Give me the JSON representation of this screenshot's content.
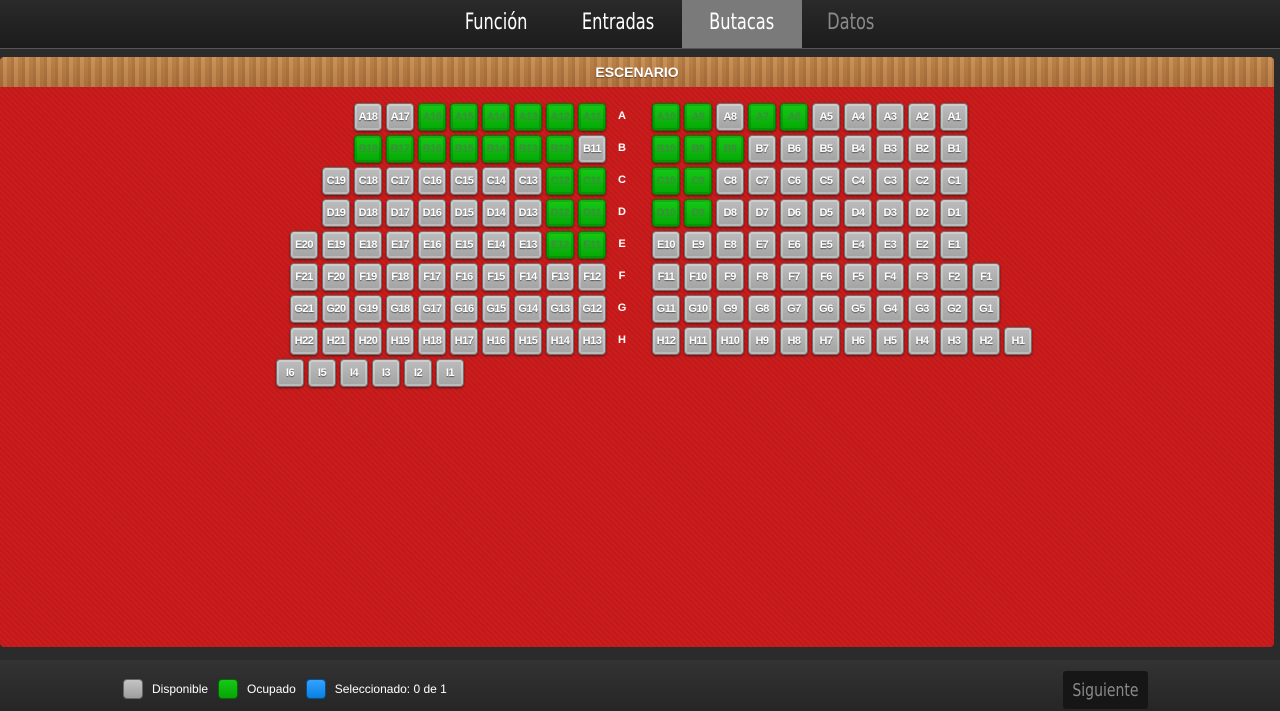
{
  "nav": {
    "tabs": [
      {
        "label": "Función",
        "state": "normal"
      },
      {
        "label": "Entradas",
        "state": "normal"
      },
      {
        "label": "Butacas",
        "state": "active"
      },
      {
        "label": "Datos",
        "state": "disabled"
      }
    ]
  },
  "stage": {
    "label": "ESCENARIO"
  },
  "rows": [
    {
      "label": "A",
      "left": [
        [
          "A18",
          "free"
        ],
        [
          "A17",
          "free"
        ],
        [
          "A16",
          "occupied"
        ],
        [
          "A15",
          "occupied"
        ],
        [
          "A14",
          "occupied"
        ],
        [
          "A13",
          "occupied"
        ],
        [
          "A12",
          "occupied"
        ],
        [
          "A11",
          "occupied"
        ]
      ],
      "right": [
        [
          "A10",
          "occupied"
        ],
        [
          "A9",
          "occupied"
        ],
        [
          "A8",
          "free"
        ],
        [
          "A7",
          "occupied"
        ],
        [
          "A6",
          "occupied"
        ],
        [
          "A5",
          "free"
        ],
        [
          "A4",
          "free"
        ],
        [
          "A3",
          "free"
        ],
        [
          "A2",
          "free"
        ],
        [
          "A1",
          "free"
        ]
      ]
    },
    {
      "label": "B",
      "left": [
        [
          "B18",
          "occupied"
        ],
        [
          "B17",
          "occupied"
        ],
        [
          "B16",
          "occupied"
        ],
        [
          "B15",
          "occupied"
        ],
        [
          "B14",
          "occupied"
        ],
        [
          "B13",
          "occupied"
        ],
        [
          "B12",
          "occupied"
        ],
        [
          "B11",
          "free"
        ]
      ],
      "right": [
        [
          "B10",
          "occupied"
        ],
        [
          "B9",
          "occupied"
        ],
        [
          "B8",
          "occupied"
        ],
        [
          "B7",
          "free"
        ],
        [
          "B6",
          "free"
        ],
        [
          "B5",
          "free"
        ],
        [
          "B4",
          "free"
        ],
        [
          "B3",
          "free"
        ],
        [
          "B2",
          "free"
        ],
        [
          "B1",
          "free"
        ]
      ]
    },
    {
      "label": "C",
      "left": [
        [
          "C19",
          "free"
        ],
        [
          "C18",
          "free"
        ],
        [
          "C17",
          "free"
        ],
        [
          "C16",
          "free"
        ],
        [
          "C15",
          "free"
        ],
        [
          "C14",
          "free"
        ],
        [
          "C13",
          "free"
        ],
        [
          "C12",
          "occupied"
        ],
        [
          "C11",
          "occupied"
        ]
      ],
      "right": [
        [
          "C10",
          "occupied"
        ],
        [
          "C9",
          "occupied"
        ],
        [
          "C8",
          "free"
        ],
        [
          "C7",
          "free"
        ],
        [
          "C6",
          "free"
        ],
        [
          "C5",
          "free"
        ],
        [
          "C4",
          "free"
        ],
        [
          "C3",
          "free"
        ],
        [
          "C2",
          "free"
        ],
        [
          "C1",
          "free"
        ]
      ]
    },
    {
      "label": "D",
      "left": [
        [
          "D19",
          "free"
        ],
        [
          "D18",
          "free"
        ],
        [
          "D17",
          "free"
        ],
        [
          "D16",
          "free"
        ],
        [
          "D15",
          "free"
        ],
        [
          "D14",
          "free"
        ],
        [
          "D13",
          "free"
        ],
        [
          "D12",
          "occupied"
        ],
        [
          "D11",
          "occupied"
        ]
      ],
      "right": [
        [
          "D10",
          "occupied"
        ],
        [
          "D9",
          "occupied"
        ],
        [
          "D8",
          "free"
        ],
        [
          "D7",
          "free"
        ],
        [
          "D6",
          "free"
        ],
        [
          "D5",
          "free"
        ],
        [
          "D4",
          "free"
        ],
        [
          "D3",
          "free"
        ],
        [
          "D2",
          "free"
        ],
        [
          "D1",
          "free"
        ]
      ]
    },
    {
      "label": "E",
      "left": [
        [
          "E20",
          "free"
        ],
        [
          "E19",
          "free"
        ],
        [
          "E18",
          "free"
        ],
        [
          "E17",
          "free"
        ],
        [
          "E16",
          "free"
        ],
        [
          "E15",
          "free"
        ],
        [
          "E14",
          "free"
        ],
        [
          "E13",
          "free"
        ],
        [
          "E12",
          "occupied"
        ],
        [
          "E11",
          "occupied"
        ]
      ],
      "right": [
        [
          "E10",
          "free"
        ],
        [
          "E9",
          "free"
        ],
        [
          "E8",
          "free"
        ],
        [
          "E7",
          "free"
        ],
        [
          "E6",
          "free"
        ],
        [
          "E5",
          "free"
        ],
        [
          "E4",
          "free"
        ],
        [
          "E3",
          "free"
        ],
        [
          "E2",
          "free"
        ],
        [
          "E1",
          "free"
        ]
      ]
    },
    {
      "label": "F",
      "left": [
        [
          "F21",
          "free"
        ],
        [
          "F20",
          "free"
        ],
        [
          "F19",
          "free"
        ],
        [
          "F18",
          "free"
        ],
        [
          "F17",
          "free"
        ],
        [
          "F16",
          "free"
        ],
        [
          "F15",
          "free"
        ],
        [
          "F14",
          "free"
        ],
        [
          "F13",
          "free"
        ],
        [
          "F12",
          "free"
        ]
      ],
      "right": [
        [
          "F11",
          "free"
        ],
        [
          "F10",
          "free"
        ],
        [
          "F9",
          "free"
        ],
        [
          "F8",
          "free"
        ],
        [
          "F7",
          "free"
        ],
        [
          "F6",
          "free"
        ],
        [
          "F5",
          "free"
        ],
        [
          "F4",
          "free"
        ],
        [
          "F3",
          "free"
        ],
        [
          "F2",
          "free"
        ],
        [
          "F1",
          "free"
        ]
      ]
    },
    {
      "label": "G",
      "left": [
        [
          "G21",
          "free"
        ],
        [
          "G20",
          "free"
        ],
        [
          "G19",
          "free"
        ],
        [
          "G18",
          "free"
        ],
        [
          "G17",
          "free"
        ],
        [
          "G16",
          "free"
        ],
        [
          "G15",
          "free"
        ],
        [
          "G14",
          "free"
        ],
        [
          "G13",
          "free"
        ],
        [
          "G12",
          "free"
        ]
      ],
      "right": [
        [
          "G11",
          "free"
        ],
        [
          "G10",
          "free"
        ],
        [
          "G9",
          "free"
        ],
        [
          "G8",
          "free"
        ],
        [
          "G7",
          "free"
        ],
        [
          "G6",
          "free"
        ],
        [
          "G5",
          "free"
        ],
        [
          "G4",
          "free"
        ],
        [
          "G3",
          "free"
        ],
        [
          "G2",
          "free"
        ],
        [
          "G1",
          "free"
        ]
      ]
    },
    {
      "label": "H",
      "left": [
        [
          "H22",
          "free"
        ],
        [
          "H21",
          "free"
        ],
        [
          "H20",
          "free"
        ],
        [
          "H19",
          "free"
        ],
        [
          "H18",
          "free"
        ],
        [
          "H17",
          "free"
        ],
        [
          "H16",
          "free"
        ],
        [
          "H15",
          "free"
        ],
        [
          "H14",
          "free"
        ],
        [
          "H13",
          "free"
        ]
      ],
      "right": [
        [
          "H12",
          "free"
        ],
        [
          "H11",
          "free"
        ],
        [
          "H10",
          "free"
        ],
        [
          "H9",
          "free"
        ],
        [
          "H8",
          "free"
        ],
        [
          "H7",
          "free"
        ],
        [
          "H6",
          "free"
        ],
        [
          "H5",
          "free"
        ],
        [
          "H4",
          "free"
        ],
        [
          "H3",
          "free"
        ],
        [
          "H2",
          "free"
        ],
        [
          "H1",
          "free"
        ]
      ]
    },
    {
      "label": "",
      "left": [
        [
          "I6",
          "free"
        ],
        [
          "I5",
          "free"
        ],
        [
          "I4",
          "free"
        ],
        [
          "I3",
          "free"
        ],
        [
          "I2",
          "free"
        ],
        [
          "I1",
          "free"
        ]
      ],
      "right": []
    }
  ],
  "legend": {
    "available": "Disponible",
    "occupied": "Ocupado",
    "selected": "Seleccionado: 0 de 1"
  },
  "colors": {
    "panel": "#c8191a",
    "available": "#b0b0b0",
    "occupied": "#0cb80c",
    "selected": "#1e90f0"
  },
  "actions": {
    "next": "Siguiente"
  }
}
